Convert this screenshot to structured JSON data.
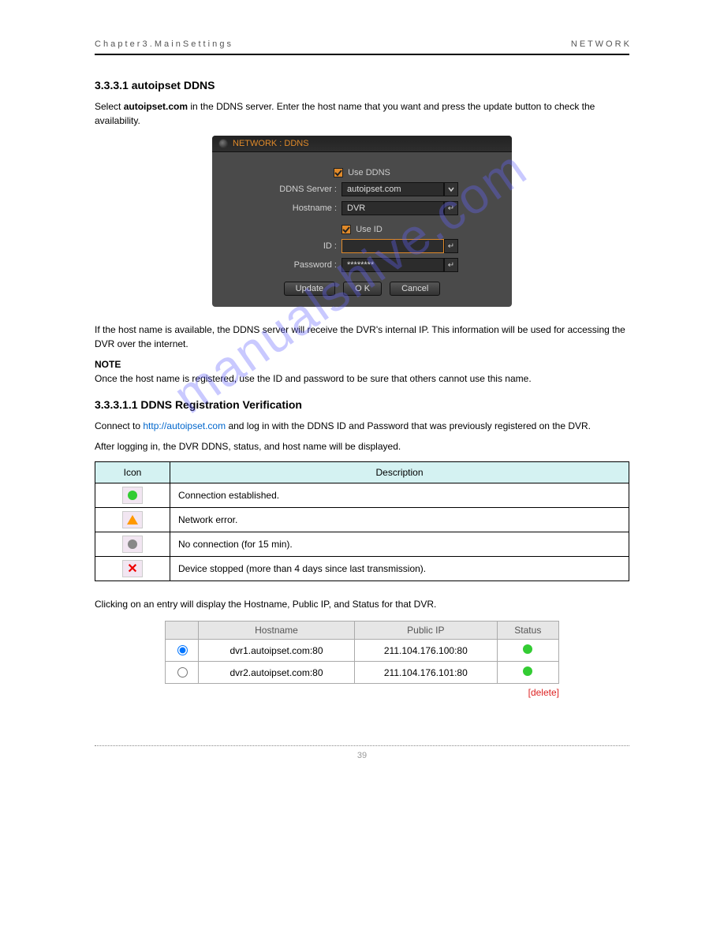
{
  "header": {
    "left": "C h a p t e r 3 .   M a i n   S e t t i n g s",
    "right": "N E T W O R K"
  },
  "section": {
    "title_number": "3.3.3.1",
    "title_text": "autoipset DDNS",
    "intro": "Select ",
    "intro_bold": "autoipset.com",
    "intro_rest": " in the DDNS server. Enter the host name that you want and press the update button to check the availability."
  },
  "dialog": {
    "title": "NETWORK : DDNS",
    "use_ddns_label": "Use DDNS",
    "use_ddns_checked": true,
    "ddns_server_label": "DDNS Server :",
    "ddns_server_value": "autoipset.com",
    "hostname_label": "Hostname :",
    "hostname_value": "DVR",
    "use_id_label": "Use ID",
    "use_id_checked": true,
    "id_label": "ID :",
    "id_value": "",
    "password_label": "Password :",
    "password_value": "********",
    "buttons": {
      "update": "Update",
      "ok": "O K",
      "cancel": "Cancel"
    }
  },
  "after_dialog": "If the host name is available, the DDNS server will receive the DVR's internal IP. This information will be used for accessing the DVR over the internet.",
  "note_label": "NOTE",
  "note_text": "Once the host name is registered, use the ID and password to be sure that others cannot use this name.",
  "subsection": {
    "title_number": "3.3.3.1.1",
    "title_text": "DDNS Registration Verification",
    "intro_1": "Connect to ",
    "intro_url": "http://autoipset.com",
    "intro_2": " and log in with the DDNS ID and Password that was previously registered on the DVR.",
    "intro_3": "After logging in, the DVR DDNS, status, and host name will be displayed.",
    "table_header_icon": "Icon",
    "table_header_desc": "Description",
    "status_rows": [
      {
        "icon": "green-dot",
        "desc": "Connection established."
      },
      {
        "icon": "orange-triangle",
        "desc": "Network error."
      },
      {
        "icon": "gray-dot",
        "desc": "No connection (for 15 min)."
      },
      {
        "icon": "red-x",
        "desc": "Device stopped (more than 4 days since last transmission)."
      }
    ],
    "below_table": "Clicking on an entry will display the Hostname, Public IP, and Status for that DVR."
  },
  "host_table": {
    "headers": {
      "hostname": "Hostname",
      "public_ip": "Public IP",
      "status": "Status"
    },
    "rows": [
      {
        "selected": true,
        "hostname": "dvr1.autoipset.com:80",
        "public_ip": "211.104.176.100:80",
        "status": "green"
      },
      {
        "selected": false,
        "hostname": "dvr2.autoipset.com:80",
        "public_ip": "211.104.176.101:80",
        "status": "green"
      }
    ],
    "delete_label": "[delete]"
  },
  "page_number": "39",
  "watermark": "manualshive.com"
}
